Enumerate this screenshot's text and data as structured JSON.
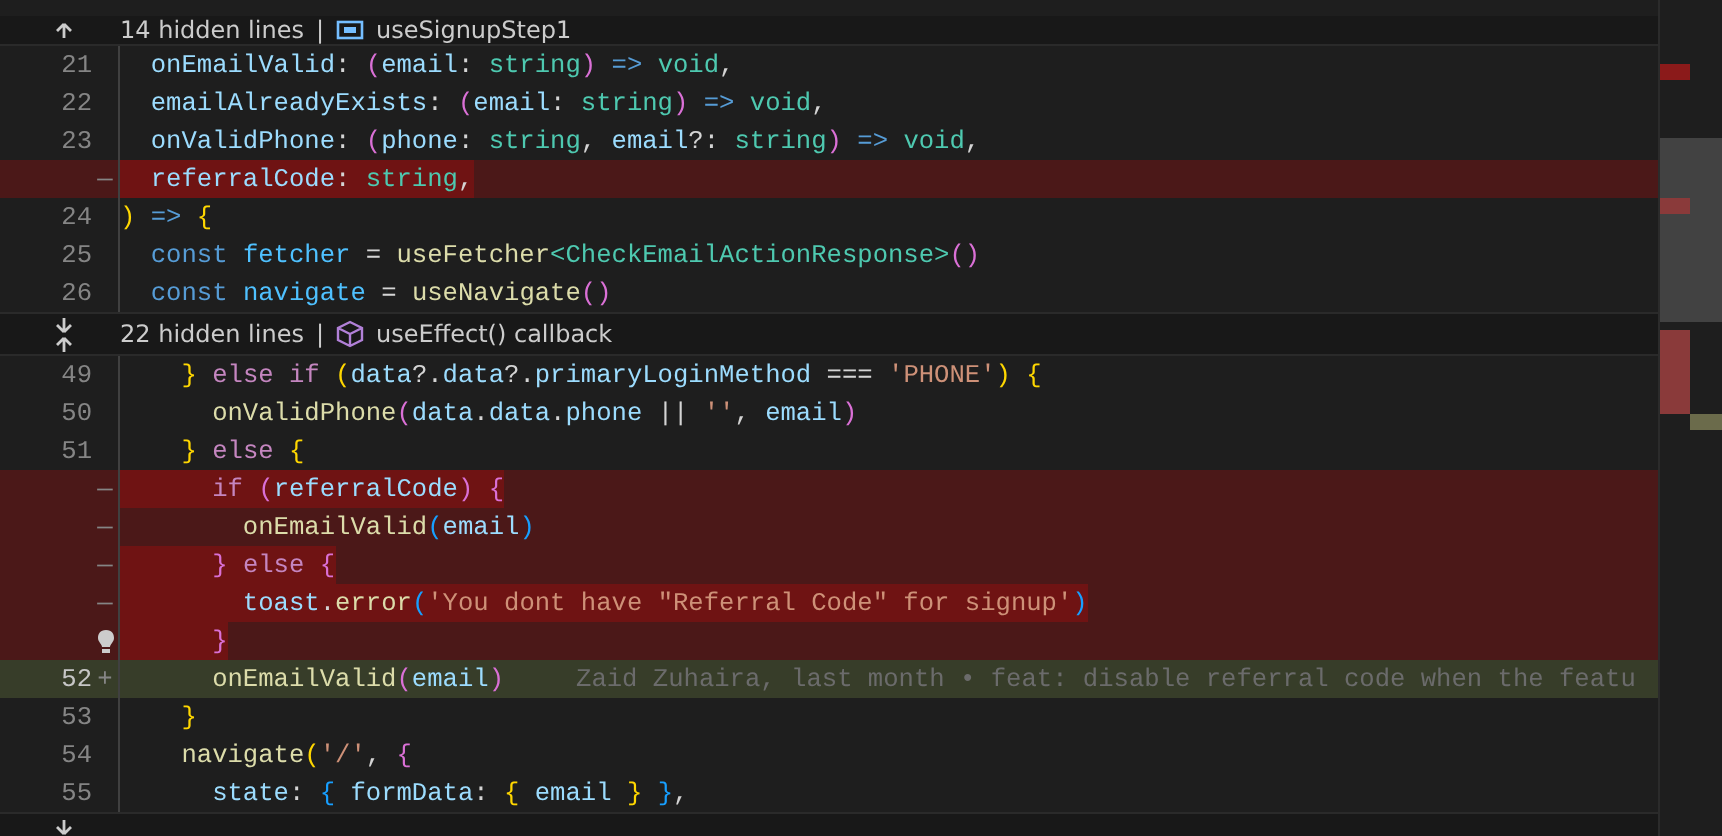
{
  "blocks": [
    {
      "kind": "fold",
      "expand_up": true,
      "hidden": "14 hidden lines",
      "separator": "|",
      "symbol": {
        "kind": "variable",
        "text": "useSignupStep1"
      }
    },
    {
      "kind": "line",
      "number": "21",
      "tokens": [
        {
          "text": "  onEmailValid",
          "kind": "var"
        },
        {
          "text": ": ",
          "kind": "plain"
        },
        {
          "text": "(",
          "kind": "b2"
        },
        {
          "text": "email",
          "kind": "var"
        },
        {
          "text": ": ",
          "kind": "plain"
        },
        {
          "text": "string",
          "kind": "type"
        },
        {
          "text": ")",
          "kind": "b2"
        },
        {
          "text": " => ",
          "kind": "kw"
        },
        {
          "text": "void",
          "kind": "type"
        },
        {
          "text": ",",
          "kind": "plain"
        }
      ]
    },
    {
      "kind": "line",
      "number": "22",
      "tokens": [
        {
          "text": "  emailAlreadyExists",
          "kind": "var"
        },
        {
          "text": ": ",
          "kind": "plain"
        },
        {
          "text": "(",
          "kind": "b2"
        },
        {
          "text": "email",
          "kind": "var"
        },
        {
          "text": ": ",
          "kind": "plain"
        },
        {
          "text": "string",
          "kind": "type"
        },
        {
          "text": ")",
          "kind": "b2"
        },
        {
          "text": " => ",
          "kind": "kw"
        },
        {
          "text": "void",
          "kind": "type"
        },
        {
          "text": ",",
          "kind": "plain"
        }
      ]
    },
    {
      "kind": "line",
      "number": "23",
      "tokens": [
        {
          "text": "  onValidPhone",
          "kind": "var"
        },
        {
          "text": ": ",
          "kind": "plain"
        },
        {
          "text": "(",
          "kind": "b2"
        },
        {
          "text": "phone",
          "kind": "var"
        },
        {
          "text": ": ",
          "kind": "plain"
        },
        {
          "text": "string",
          "kind": "type"
        },
        {
          "text": ", ",
          "kind": "plain"
        },
        {
          "text": "email",
          "kind": "var"
        },
        {
          "text": "?: ",
          "kind": "plain"
        },
        {
          "text": "string",
          "kind": "type"
        },
        {
          "text": ")",
          "kind": "b2"
        },
        {
          "text": " => ",
          "kind": "kw"
        },
        {
          "text": "void",
          "kind": "type"
        },
        {
          "text": ",",
          "kind": "plain"
        }
      ]
    },
    {
      "kind": "removed",
      "marker": "—",
      "emphasis": true,
      "tokens": [
        {
          "text": "  referralCode",
          "kind": "var"
        },
        {
          "text": ": ",
          "kind": "plain"
        },
        {
          "text": "string",
          "kind": "type"
        },
        {
          "text": ",",
          "kind": "plain"
        }
      ]
    },
    {
      "kind": "line",
      "number": "24",
      "tokens": [
        {
          "text": ")",
          "kind": "b1"
        },
        {
          "text": " => ",
          "kind": "kw"
        },
        {
          "text": "{",
          "kind": "b1"
        }
      ]
    },
    {
      "kind": "line",
      "number": "25",
      "tokens": [
        {
          "text": "  const",
          "kind": "kw"
        },
        {
          "text": " fetcher",
          "kind": "const"
        },
        {
          "text": " = ",
          "kind": "plain"
        },
        {
          "text": "useFetcher",
          "kind": "fn"
        },
        {
          "text": "<CheckEmailActionResponse>",
          "kind": "type"
        },
        {
          "text": "()",
          "kind": "b2"
        }
      ]
    },
    {
      "kind": "line",
      "number": "26",
      "tokens": [
        {
          "text": "  const",
          "kind": "kw"
        },
        {
          "text": " navigate",
          "kind": "const"
        },
        {
          "text": " = ",
          "kind": "plain"
        },
        {
          "text": "useNavigate",
          "kind": "fn"
        },
        {
          "text": "()",
          "kind": "b2"
        }
      ]
    },
    {
      "kind": "fold",
      "expand_down": true,
      "expand_up": true,
      "hidden": "22 hidden lines",
      "separator": "|",
      "symbol": {
        "kind": "method",
        "text": "useEffect() callback"
      }
    },
    {
      "kind": "line",
      "number": "49",
      "tokens": [
        {
          "text": "    }",
          "kind": "b1"
        },
        {
          "text": " else if ",
          "kind": "ctl"
        },
        {
          "text": "(",
          "kind": "b1"
        },
        {
          "text": "data",
          "kind": "var"
        },
        {
          "text": "?.",
          "kind": "plain"
        },
        {
          "text": "data",
          "kind": "var"
        },
        {
          "text": "?.",
          "kind": "plain"
        },
        {
          "text": "primaryLoginMethod",
          "kind": "var"
        },
        {
          "text": " === ",
          "kind": "plain"
        },
        {
          "text": "'PHONE'",
          "kind": "str"
        },
        {
          "text": ")",
          "kind": "b1"
        },
        {
          "text": " {",
          "kind": "b1"
        }
      ]
    },
    {
      "kind": "line",
      "number": "50",
      "tokens": [
        {
          "text": "      onValidPhone",
          "kind": "fn"
        },
        {
          "text": "(",
          "kind": "b2"
        },
        {
          "text": "data",
          "kind": "var"
        },
        {
          "text": ".",
          "kind": "plain"
        },
        {
          "text": "data",
          "kind": "var"
        },
        {
          "text": ".",
          "kind": "plain"
        },
        {
          "text": "phone",
          "kind": "var"
        },
        {
          "text": " || ",
          "kind": "plain"
        },
        {
          "text": "''",
          "kind": "str"
        },
        {
          "text": ", ",
          "kind": "plain"
        },
        {
          "text": "email",
          "kind": "var"
        },
        {
          "text": ")",
          "kind": "b2"
        }
      ]
    },
    {
      "kind": "line",
      "number": "51",
      "tokens": [
        {
          "text": "    }",
          "kind": "b1"
        },
        {
          "text": " else ",
          "kind": "ctl"
        },
        {
          "text": "{",
          "kind": "b1"
        }
      ]
    },
    {
      "kind": "removed",
      "marker": "—",
      "emphasis": true,
      "tokens": [
        {
          "text": "      if ",
          "kind": "ctl"
        },
        {
          "text": "(",
          "kind": "b2"
        },
        {
          "text": "referralCode",
          "kind": "var"
        },
        {
          "text": ") {",
          "kind": "b2"
        }
      ]
    },
    {
      "kind": "removed",
      "marker": "—",
      "emphasis": false,
      "tokens": [
        {
          "text": "        onEmailValid",
          "kind": "fn"
        },
        {
          "text": "(",
          "kind": "b3"
        },
        {
          "text": "email",
          "kind": "var"
        },
        {
          "text": ")",
          "kind": "b3"
        }
      ]
    },
    {
      "kind": "removed",
      "marker": "—",
      "emphasis": true,
      "tokens": [
        {
          "text": "      }",
          "kind": "b2"
        },
        {
          "text": " else ",
          "kind": "ctl"
        },
        {
          "text": "{",
          "kind": "b2"
        }
      ]
    },
    {
      "kind": "removed",
      "marker": "—",
      "emphasis": true,
      "tokens": [
        {
          "text": "        toast",
          "kind": "var"
        },
        {
          "text": ".",
          "kind": "plain"
        },
        {
          "text": "error",
          "kind": "fn"
        },
        {
          "text": "(",
          "kind": "b3"
        },
        {
          "text": "'You dont have \"Referral Code\" for signup'",
          "kind": "str"
        },
        {
          "text": ")",
          "kind": "b3"
        }
      ]
    },
    {
      "kind": "removed",
      "lightbulb": true,
      "emphasis": true,
      "tokens": [
        {
          "text": "      }",
          "kind": "b2"
        }
      ]
    },
    {
      "kind": "added",
      "number": "52",
      "current": true,
      "marker": "+",
      "tokens": [
        {
          "text": "      onEmailValid",
          "kind": "fn"
        },
        {
          "text": "(",
          "kind": "b2"
        },
        {
          "text": "email",
          "kind": "var"
        },
        {
          "text": ")",
          "kind": "b2"
        }
      ],
      "blame": "Zaid Zuhaira, last month • feat: disable referral code when the featu"
    },
    {
      "kind": "line",
      "number": "53",
      "tokens": [
        {
          "text": "    }",
          "kind": "b1"
        }
      ]
    },
    {
      "kind": "line",
      "number": "54",
      "tokens": [
        {
          "text": "    navigate",
          "kind": "fn"
        },
        {
          "text": "(",
          "kind": "b1"
        },
        {
          "text": "'/'",
          "kind": "str"
        },
        {
          "text": ", ",
          "kind": "plain"
        },
        {
          "text": "{",
          "kind": "b2"
        }
      ]
    },
    {
      "kind": "line",
      "number": "55",
      "tokens": [
        {
          "text": "      state",
          "kind": "var"
        },
        {
          "text": ": ",
          "kind": "plain"
        },
        {
          "text": "{",
          "kind": "b3"
        },
        {
          "text": " formData",
          "kind": "var"
        },
        {
          "text": ": ",
          "kind": "plain"
        },
        {
          "text": "{",
          "kind": "b1"
        },
        {
          "text": " email ",
          "kind": "var"
        },
        {
          "text": "}",
          "kind": "b1"
        },
        {
          "text": " }",
          "kind": "b3"
        },
        {
          "text": ",",
          "kind": "plain"
        }
      ]
    },
    {
      "kind": "fold",
      "expand_down": true
    }
  ]
}
